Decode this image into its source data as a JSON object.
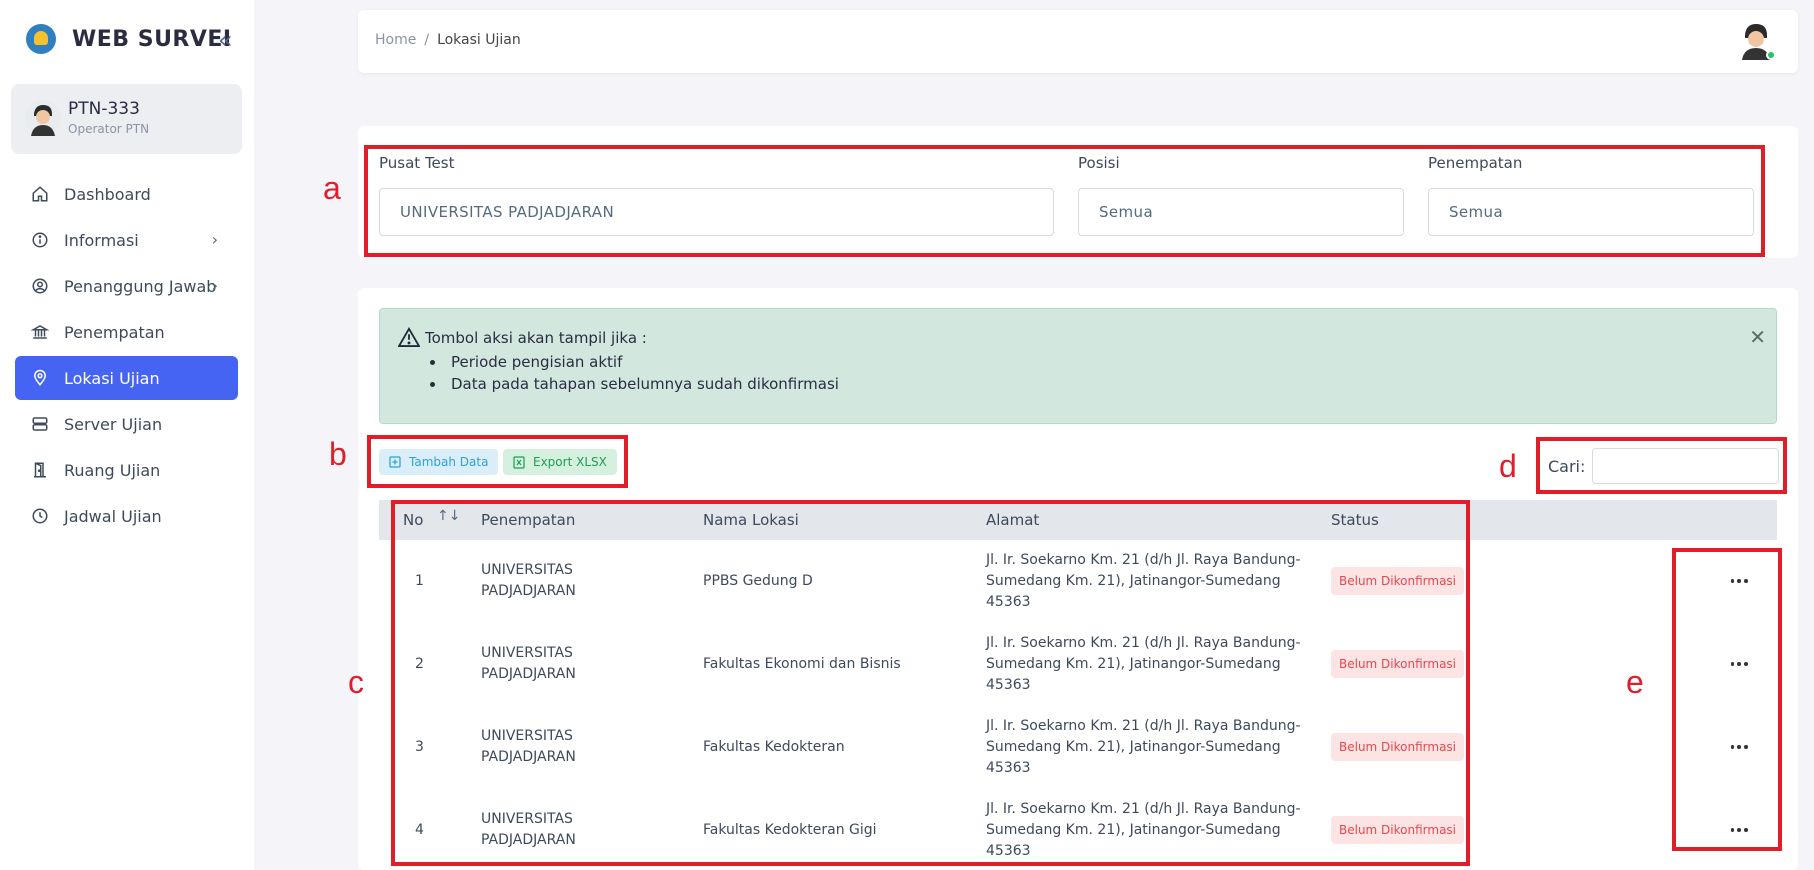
{
  "sidebar": {
    "brand": "WEB SURVEI",
    "collapse_icon": "double-chevron-left-icon",
    "user": {
      "name": "PTN-333",
      "role": "Operator PTN"
    },
    "items": [
      {
        "label": "Dashboard",
        "icon": "home-icon",
        "has_children": false,
        "active": false
      },
      {
        "label": "Informasi",
        "icon": "info-icon",
        "has_children": true,
        "active": false
      },
      {
        "label": "Penanggung Jawab",
        "icon": "user-circle-icon",
        "has_children": true,
        "active": false
      },
      {
        "label": "Penempatan",
        "icon": "bank-icon",
        "has_children": false,
        "active": false
      },
      {
        "label": "Lokasi Ujian",
        "icon": "map-pin-icon",
        "has_children": false,
        "active": true
      },
      {
        "label": "Server Ujian",
        "icon": "server-icon",
        "has_children": false,
        "active": false
      },
      {
        "label": "Ruang Ujian",
        "icon": "door-icon",
        "has_children": false,
        "active": false
      },
      {
        "label": "Jadwal Ujian",
        "icon": "clock-icon",
        "has_children": false,
        "active": false
      }
    ]
  },
  "header": {
    "breadcrumb": {
      "home": "Home",
      "separator": "/",
      "current": "Lokasi Ujian"
    }
  },
  "filters": {
    "pusat_test": {
      "label": "Pusat Test",
      "value": "UNIVERSITAS PADJADJARAN"
    },
    "posisi": {
      "label": "Posisi",
      "value": "Semua"
    },
    "penempatan": {
      "label": "Penempatan",
      "value": "Semua"
    }
  },
  "alert": {
    "title": "Tombol aksi akan tampil jika :",
    "items": [
      "Periode pengisian aktif",
      "Data pada tahapan sebelumnya sudah dikonfirmasi"
    ],
    "close": "✕"
  },
  "toolbar": {
    "add_label": "Tambah Data",
    "export_label": "Export XLSX"
  },
  "search": {
    "label": "Cari:"
  },
  "table": {
    "headers": {
      "no": "No",
      "penempatan": "Penempatan",
      "nama_lokasi": "Nama Lokasi",
      "alamat": "Alamat",
      "status": "Status"
    },
    "rows": [
      {
        "no": "1",
        "penempatan": [
          "UNIVERSITAS",
          "PADJADJARAN"
        ],
        "nama_lokasi": "PPBS Gedung D",
        "alamat": [
          "Jl. Ir. Soekarno Km. 21 (d/h Jl. Raya Bandung-",
          "Sumedang Km. 21), Jatinangor-Sumedang",
          "45363"
        ],
        "status": "Belum Dikonfirmasi"
      },
      {
        "no": "2",
        "penempatan": [
          "UNIVERSITAS",
          "PADJADJARAN"
        ],
        "nama_lokasi": "Fakultas Ekonomi dan Bisnis",
        "alamat": [
          "Jl. Ir. Soekarno Km. 21 (d/h Jl. Raya Bandung-",
          "Sumedang Km. 21), Jatinangor-Sumedang",
          "45363"
        ],
        "status": "Belum Dikonfirmasi"
      },
      {
        "no": "3",
        "penempatan": [
          "UNIVERSITAS",
          "PADJADJARAN"
        ],
        "nama_lokasi": "Fakultas Kedokteran",
        "alamat": [
          "Jl. Ir. Soekarno Km. 21 (d/h Jl. Raya Bandung-",
          "Sumedang Km. 21), Jatinangor-Sumedang",
          "45363"
        ],
        "status": "Belum Dikonfirmasi"
      },
      {
        "no": "4",
        "penempatan": [
          "UNIVERSITAS",
          "PADJADJARAN"
        ],
        "nama_lokasi": "Fakultas Kedokteran Gigi",
        "alamat": [
          "Jl. Ir. Soekarno Km. 21 (d/h Jl. Raya Bandung-",
          "Sumedang Km. 21), Jatinangor-Sumedang",
          "45363"
        ],
        "status": "Belum Dikonfirmasi"
      }
    ]
  },
  "annotations": {
    "a": "a",
    "b": "b",
    "c": "c",
    "d": "d",
    "e": "e"
  },
  "colors": {
    "accent": "#4664f2",
    "annotation": "#e11d2a",
    "alert_bg": "#d2e8df",
    "badge_bg": "#fce4e4",
    "badge_text": "#e5484d"
  }
}
